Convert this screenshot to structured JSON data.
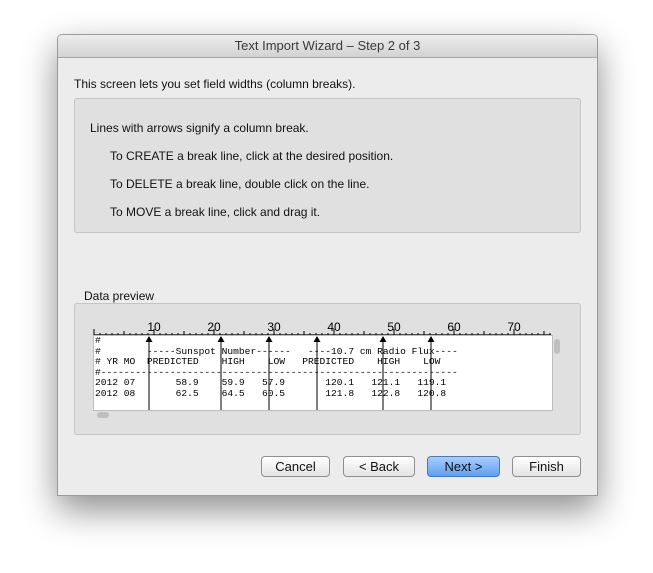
{
  "window": {
    "title": "Text Import Wizard – Step 2 of 3"
  },
  "intro": "This screen lets you set field widths (column breaks).",
  "instructions": {
    "line1": "Lines with arrows signify a column break.",
    "line2": "To CREATE a break line, click at the desired position.",
    "line3": "To DELETE a break line, double click on the line.",
    "line4": "To MOVE a break line, click and drag it."
  },
  "preview": {
    "label": "Data preview",
    "ruler_labels": [
      "10",
      "20",
      "30",
      "40",
      "50",
      "60",
      "70"
    ],
    "column_breaks": [
      9,
      21,
      29,
      37,
      48,
      56
    ],
    "rows": [
      "#",
      "#        -----Sunspot Number------   ----10.7 cm Radio Flux----",
      "# YR MO  PREDICTED    HIGH    LOW   PREDICTED    HIGH    LOW",
      "#--------------------------------------------------------------",
      "2012 07       58.9    59.9   57.9       120.1   121.1   119.1",
      "2012 08       62.5    64.5   60.5       121.8   122.8   120.8"
    ]
  },
  "buttons": {
    "cancel": "Cancel",
    "back": "< Back",
    "next": "Next >",
    "finish": "Finish"
  }
}
